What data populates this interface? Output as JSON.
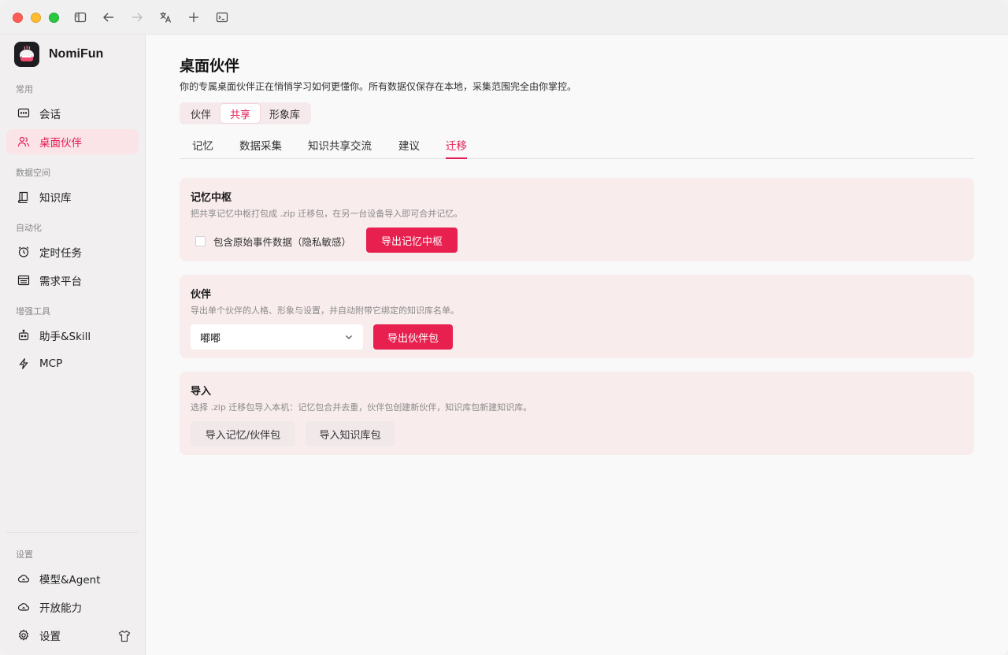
{
  "app": {
    "name": "NomiFun"
  },
  "sidebar": {
    "sections": {
      "common": "常用",
      "data_space": "数据空间",
      "automation": "自动化",
      "tools": "增强工具",
      "settings": "设置"
    },
    "items": [
      {
        "label": "会话",
        "icon": "chat-icon"
      },
      {
        "label": "桌面伙伴",
        "icon": "users-icon",
        "active": true
      },
      {
        "label": "知识库",
        "icon": "book-icon"
      },
      {
        "label": "定时任务",
        "icon": "alarm-icon"
      },
      {
        "label": "需求平台",
        "icon": "list-icon"
      },
      {
        "label": "助手&Skill",
        "icon": "robot-icon"
      },
      {
        "label": "MCP",
        "icon": "bolt-icon"
      },
      {
        "label": "模型&Agent",
        "icon": "cloud-icon"
      },
      {
        "label": "开放能力",
        "icon": "cloud-icon"
      },
      {
        "label": "设置",
        "icon": "gear-icon"
      }
    ]
  },
  "main": {
    "title": "桌面伙伴",
    "subtitle": "你的专属桌面伙伴正在悄悄学习如何更懂你。所有数据仅保存在本地，采集范围完全由你掌控。",
    "segments": [
      "伙伴",
      "共享",
      "形象库"
    ],
    "active_segment": "共享",
    "tabs": [
      "记忆",
      "数据采集",
      "知识共享交流",
      "建议",
      "迁移"
    ],
    "active_tab": "迁移",
    "cards": {
      "memory": {
        "title": "记忆中枢",
        "desc": "把共享记忆中枢打包成 .zip 迁移包，在另一台设备导入即可合并记忆。",
        "checkbox_label": "包含原始事件数据（隐私敏感）",
        "checkbox_checked": false,
        "button": "导出记忆中枢"
      },
      "companion": {
        "title": "伙伴",
        "desc": "导出单个伙伴的人格、形象与设置，并自动附带它绑定的知识库名单。",
        "select_value": "嘟嘟",
        "button": "导出伙伴包"
      },
      "import": {
        "title": "导入",
        "desc": "选择 .zip 迁移包导入本机：记忆包合并去重，伙伴包创建新伙伴，知识库包新建知识库。",
        "button_memory": "导入记忆/伙伴包",
        "button_kb": "导入知识库包"
      }
    }
  },
  "colors": {
    "accent": "#e31e55",
    "card_bg": "#f9eced",
    "sidebar_bg": "#f1eff0"
  }
}
